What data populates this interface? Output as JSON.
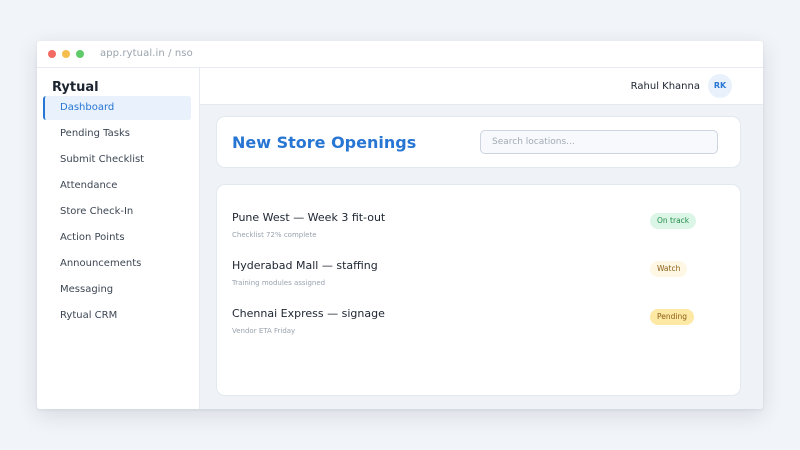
{
  "browser": {
    "url": "app.rytual.in / nso"
  },
  "sidebar": {
    "brand": "Rytual",
    "items": [
      {
        "label": "Dashboard",
        "active": true
      },
      {
        "label": "Pending Tasks"
      },
      {
        "label": "Submit Checklist"
      },
      {
        "label": "Attendance"
      },
      {
        "label": "Store Check-In"
      },
      {
        "label": "Action Points"
      },
      {
        "label": "Announcements"
      },
      {
        "label": "Messaging"
      },
      {
        "label": "Rytual CRM"
      }
    ]
  },
  "header": {
    "user_name": "Rahul Khanna",
    "avatar_initials": "RK"
  },
  "page": {
    "title": "New Store Openings",
    "search": {
      "value": "",
      "placeholder": "Search locations..."
    }
  },
  "stores": [
    {
      "title": "Pune West — Week 3 fit-out",
      "subtitle": "Checklist 72% complete",
      "status": "On track"
    },
    {
      "title": "Hyderabad Mall — staffing",
      "subtitle": "Training modules assigned",
      "status": "Watch"
    },
    {
      "title": "Chennai Express — signage",
      "subtitle": "Vendor ETA Friday",
      "status": "Pending"
    }
  ],
  "colors": {
    "accent": "#2876d3",
    "on_track": "#dbf6e6",
    "watch": "#fdf7e4",
    "pending": "#fde9a4"
  }
}
